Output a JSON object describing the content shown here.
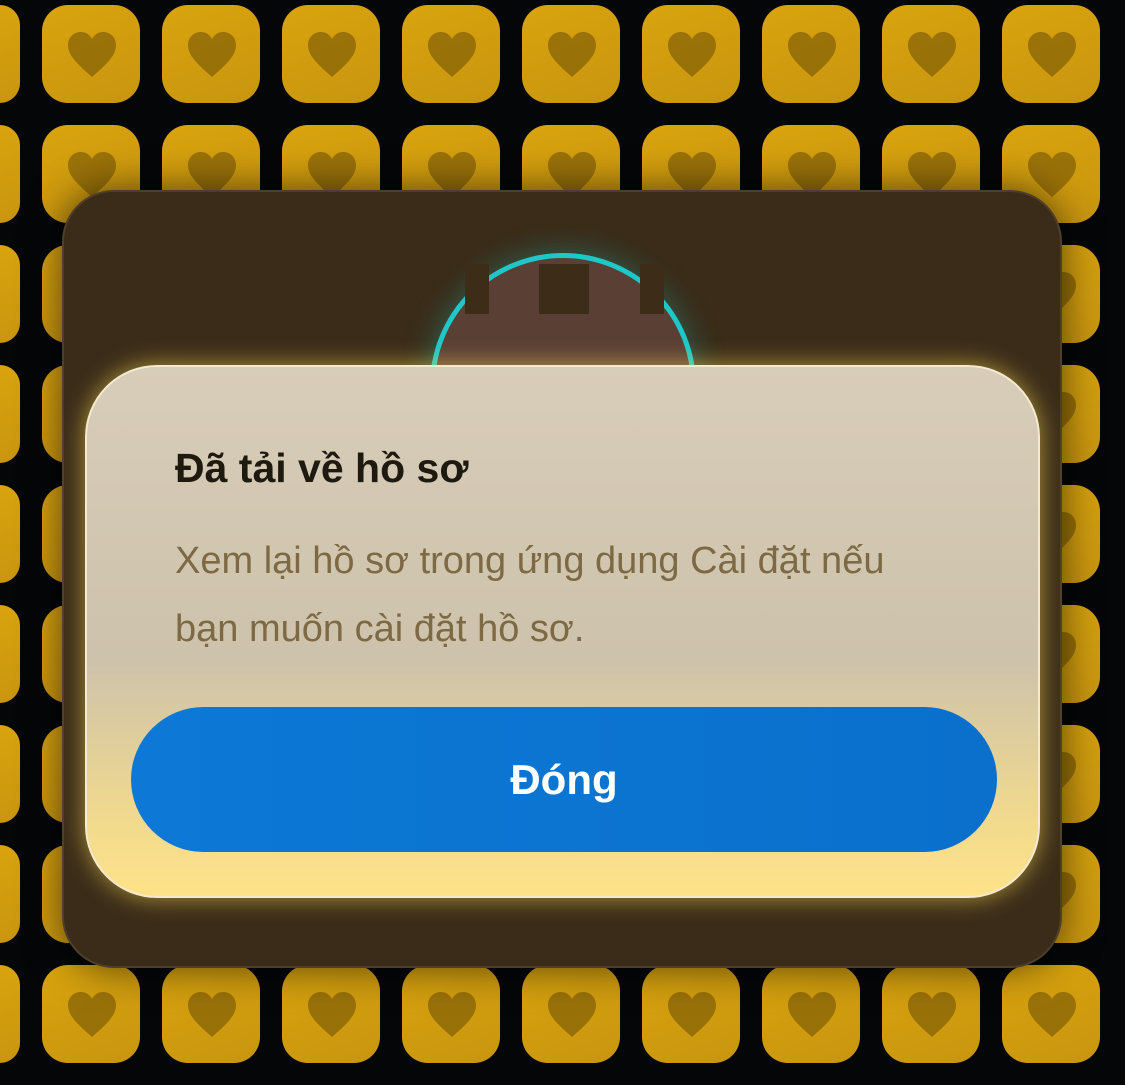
{
  "dialog": {
    "title": "Đã tải về hồ sơ",
    "message": "Xem lại hồ sơ trong ứng dụng Cài đặt nếu bạn muốn cài đặt hồ sơ.",
    "close_label": "Đóng"
  },
  "background": {
    "tile_icon": "heart-icon",
    "tile_color": "#d39f0d",
    "accent_ring_color": "#1ec8c8",
    "button_color": "#0d78d6"
  }
}
